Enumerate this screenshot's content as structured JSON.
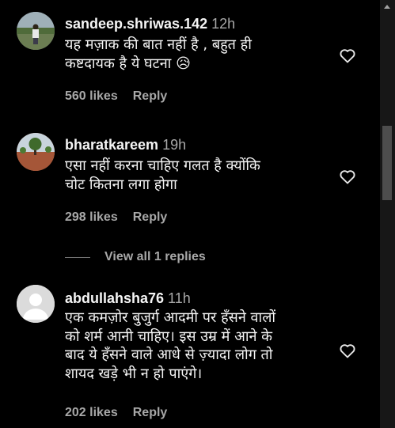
{
  "comments": [
    {
      "username": "sandeep.shriwas.142",
      "time": "12h",
      "text_lines": [
        "यह मज़ाक की बात नहीं है , बहुत ही",
        "कष्टदायक है ये घटना 😥"
      ],
      "likes": "560 likes",
      "reply": "Reply",
      "avatar": "landscape-person-photo"
    },
    {
      "username": "bharatkareem",
      "time": "19h",
      "text_lines": [
        "एसा नहीं करना चाहिए गलत है क्योंकि",
        "चोट कितना लगा होगा"
      ],
      "likes": "298 likes",
      "reply": "Reply",
      "avatar": "tree-field-photo"
    },
    {
      "username": "abdullahsha76",
      "time": "11h",
      "text_lines": [
        "एक कमज़ोर बुजुर्ग आदमी पर हँसने वालों",
        "को शर्म आनी चाहिए। इस उम्र में आने के",
        "बाद ये हँसने वाले आधे से ज़्यादा लोग तो",
        "शायद खड़े भी न हो पाएंगे।"
      ],
      "likes": "202 likes",
      "reply": "Reply",
      "avatar": "default-user-avatar"
    }
  ],
  "view_replies": "View all 1 replies",
  "icons": {
    "like": "heart-outline-icon"
  },
  "colors": {
    "background": "#000000",
    "text_primary": "#f5f5f5",
    "text_secondary": "#a8a8a8",
    "scrollbar_track": "#171717",
    "scrollbar_thumb": "#4d4d4d"
  }
}
